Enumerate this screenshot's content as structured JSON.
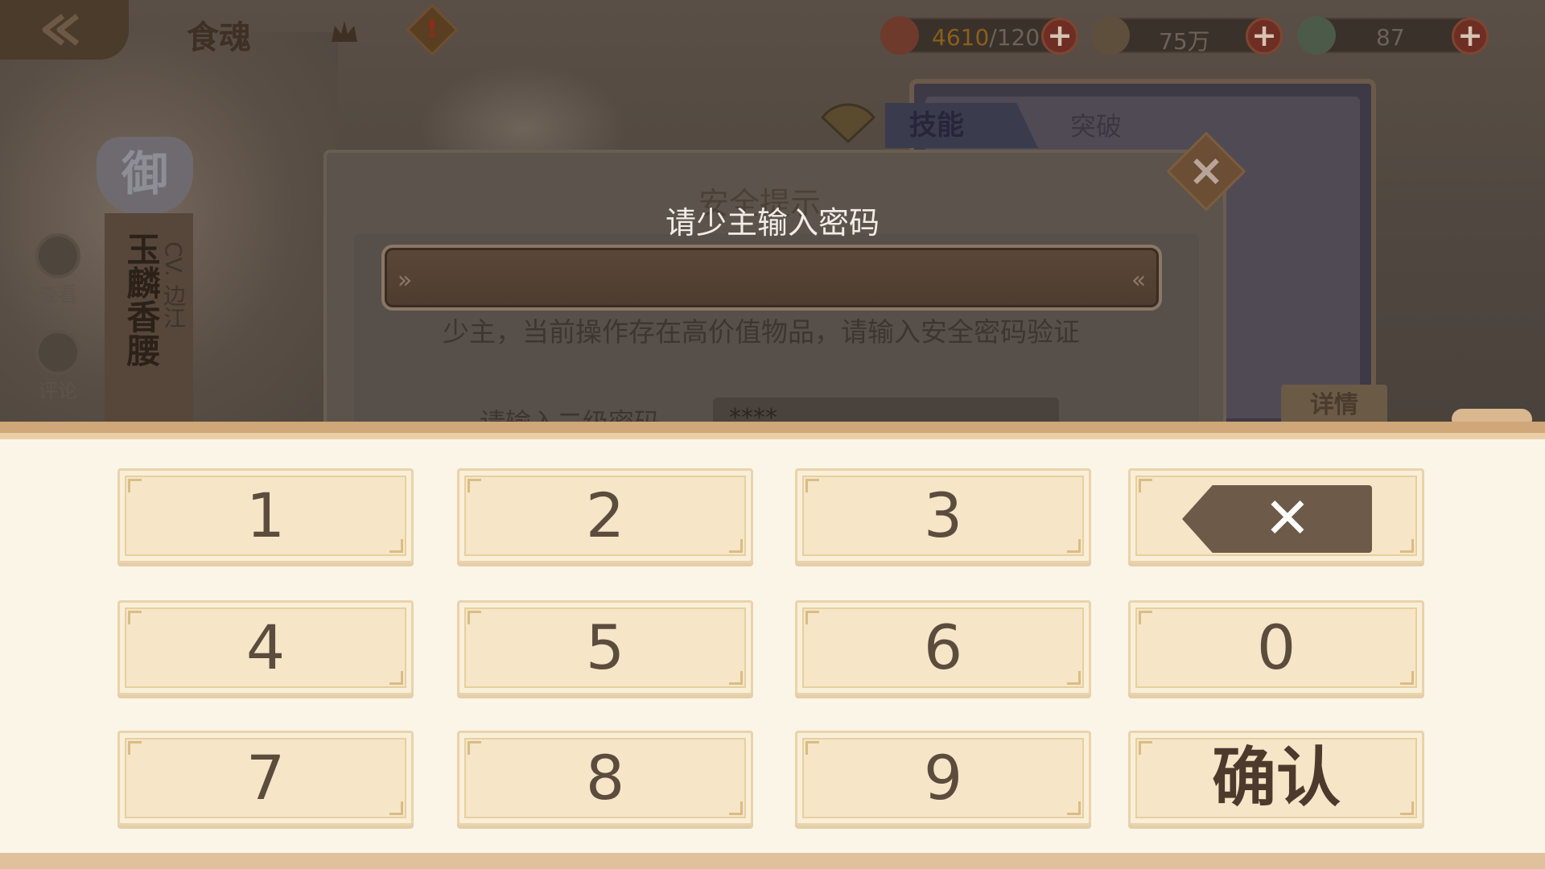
{
  "topbar": {
    "title": "食魂",
    "resources": [
      {
        "name": "stamina",
        "value_current": "4610",
        "value_rest": "/120",
        "icon": "bowl-icon"
      },
      {
        "name": "gold",
        "value": "75万",
        "icon": "coin-icon"
      },
      {
        "name": "crystal",
        "value": "87",
        "icon": "gem-icon"
      }
    ]
  },
  "character": {
    "rank_badge": "御",
    "name": "玉麟香腰",
    "cv": "CV. 边江"
  },
  "side_buttons": {
    "view": "查看",
    "comment": "评论"
  },
  "tabs": {
    "skill": "技能",
    "breakthrough": "突破"
  },
  "detail_button": "详情",
  "security_dialog": {
    "title": "安全提示",
    "description": "少主，当前操作存在高价值物品，请输入安全密码验证",
    "label": "请输入二级密码",
    "input_value": "****"
  },
  "password_prompt": {
    "title": "请少主输入密码",
    "value": ""
  },
  "keypad": {
    "keys": [
      "1",
      "2",
      "3",
      "4",
      "5",
      "6",
      "0",
      "7",
      "8",
      "9"
    ],
    "confirm": "确认"
  },
  "colors": {
    "keypad_bg": "#fbf5e7",
    "key_bg": "#f6e6c7",
    "key_text": "#5c4c3e",
    "delete_bg": "#6d5a49",
    "accent_border": "#cfa778"
  }
}
